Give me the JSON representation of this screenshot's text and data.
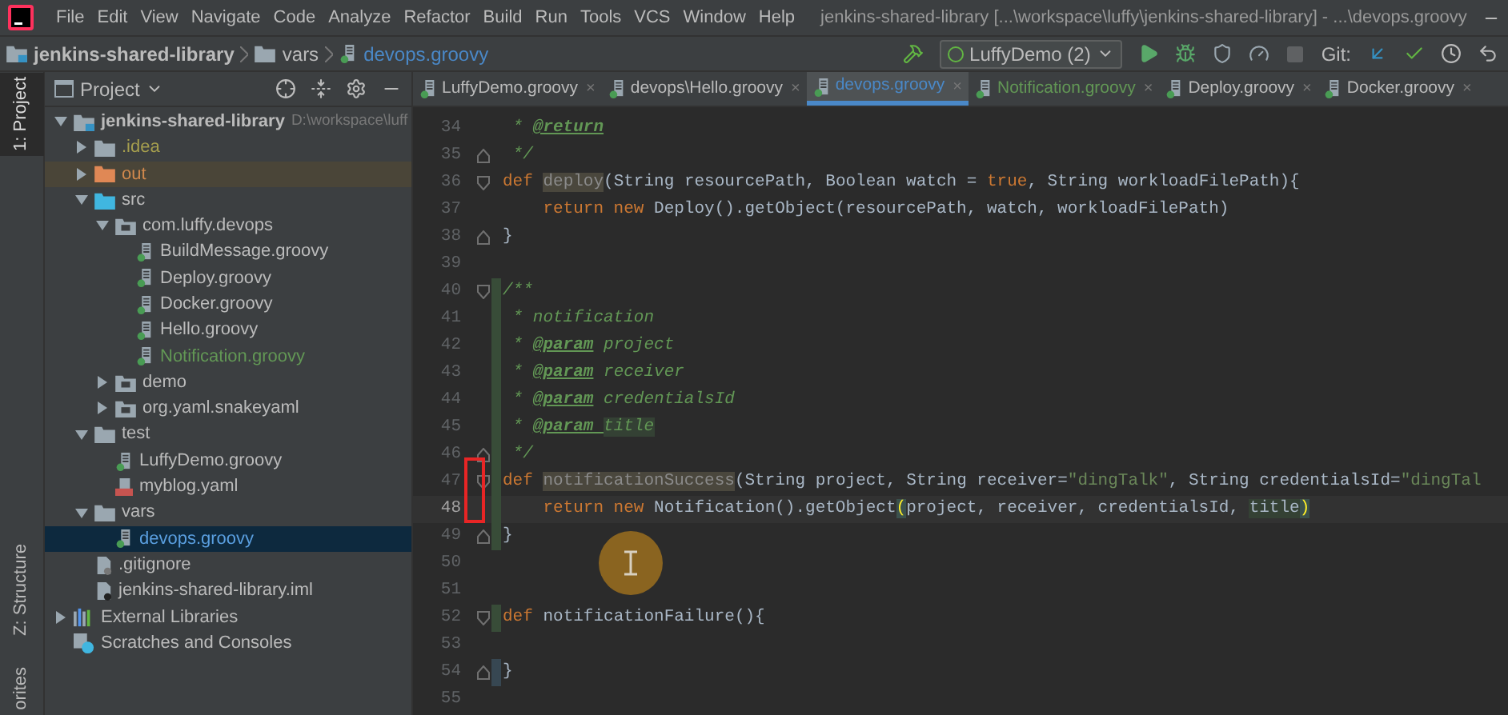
{
  "title_bar": {
    "menu": [
      "File",
      "Edit",
      "View",
      "Navigate",
      "Code",
      "Analyze",
      "Refactor",
      "Build",
      "Run",
      "Tools",
      "VCS",
      "Window",
      "Help"
    ],
    "title": "jenkins-shared-library [...\\workspace\\luffy\\jenkins-shared-library] - ...\\devops.groovy"
  },
  "nav_bar": {
    "breadcrumbs": [
      {
        "label": "jenkins-shared-library",
        "kind": "module"
      },
      {
        "label": "vars",
        "kind": "folder"
      },
      {
        "label": "devops.groovy",
        "kind": "groovy"
      }
    ],
    "run_config": "LuffyDemo (2)",
    "git_label": "Git:"
  },
  "side_strip": {
    "top": [
      {
        "label": "1: Project",
        "selected": true
      }
    ],
    "bottom": [
      {
        "label": "Z: Structure",
        "selected": false
      },
      {
        "label": "orites",
        "selected": false
      }
    ]
  },
  "project_panel": {
    "title": "Project",
    "tree": [
      {
        "name": "jenkins-shared-library",
        "path": "D:\\workspace\\luff",
        "kind": "module",
        "color": "#bbbbbb",
        "expanded": true,
        "selected": false,
        "children": [
          {
            "name": ".idea",
            "kind": "folder",
            "color": "#a59e4e",
            "expanded": false,
            "selected": false
          },
          {
            "name": "out",
            "kind": "excluded-folder",
            "color": "#d0884d",
            "expanded": false,
            "selected": false
          },
          {
            "name": "src",
            "kind": "source-folder",
            "color": "#bbbbbb",
            "expanded": true,
            "selected": false,
            "children": [
              {
                "name": "com.luffy.devops",
                "kind": "package",
                "color": "#bbbbbb",
                "expanded": true,
                "selected": false,
                "children": [
                  {
                    "name": "BuildMessage.groovy",
                    "kind": "groovy",
                    "color": "#bbbbbb",
                    "selected": false
                  },
                  {
                    "name": "Deploy.groovy",
                    "kind": "groovy",
                    "color": "#bbbbbb",
                    "selected": false
                  },
                  {
                    "name": "Docker.groovy",
                    "kind": "groovy",
                    "color": "#bbbbbb",
                    "selected": false
                  },
                  {
                    "name": "Hello.groovy",
                    "kind": "groovy",
                    "color": "#bbbbbb",
                    "selected": false
                  },
                  {
                    "name": "Notification.groovy",
                    "kind": "groovy",
                    "color": "#629755",
                    "selected": false
                  }
                ]
              },
              {
                "name": "demo",
                "kind": "package",
                "color": "#bbbbbb",
                "expanded": false,
                "selected": false
              },
              {
                "name": "org.yaml.snakeyaml",
                "kind": "package",
                "color": "#bbbbbb",
                "expanded": false,
                "selected": false
              }
            ]
          },
          {
            "name": "test",
            "kind": "folder",
            "color": "#bbbbbb",
            "expanded": true,
            "selected": false,
            "children": [
              {
                "name": "LuffyDemo.groovy",
                "kind": "groovy",
                "color": "#bbbbbb",
                "selected": false
              },
              {
                "name": "myblog.yaml",
                "kind": "yaml",
                "color": "#bbbbbb",
                "selected": false
              }
            ]
          },
          {
            "name": "vars",
            "kind": "folder",
            "color": "#bbbbbb",
            "expanded": true,
            "selected": false,
            "children": [
              {
                "name": "devops.groovy",
                "kind": "groovy",
                "selected": true
              }
            ]
          },
          {
            "name": ".gitignore",
            "kind": "ignore-file",
            "color": "#bbbbbb",
            "selected": false
          },
          {
            "name": "jenkins-shared-library.iml",
            "kind": "iml",
            "color": "#bbbbbb",
            "selected": false
          }
        ]
      },
      {
        "name": "External Libraries",
        "kind": "libraries",
        "color": "#bbbbbb",
        "expanded": false,
        "selected": false
      },
      {
        "name": "Scratches and Consoles",
        "kind": "scratches",
        "color": "#bbbbbb",
        "selected": false
      }
    ]
  },
  "editor": {
    "tabs": [
      {
        "label": "LuffyDemo.groovy",
        "close": "×",
        "color": "#bbbbbb",
        "selected": false
      },
      {
        "label": "devops\\Hello.groovy",
        "close": "×",
        "color": "#bbbbbb",
        "selected": false
      },
      {
        "label": "devops.groovy",
        "close": "×",
        "color": "#4a88c7",
        "selected": true
      },
      {
        "label": "Notification.groovy",
        "close": "×",
        "color": "#629755",
        "selected": false
      },
      {
        "label": "Deploy.groovy",
        "close": "×",
        "color": "#bbbbbb",
        "selected": false
      },
      {
        "label": "Docker.groovy",
        "close": "×",
        "color": "#bbbbbb",
        "selected": false
      }
    ],
    "lines": [
      {
        "number": "34",
        "kind": "plain",
        "current": false,
        "segments": [
          {
            "kind": "comment",
            "text": " * "
          },
          {
            "kind": "tag",
            "text": "@return"
          }
        ]
      },
      {
        "number": "35",
        "kind": "fold-end",
        "current": false,
        "segments": [
          {
            "kind": "comment",
            "text": " */"
          }
        ]
      },
      {
        "number": "36",
        "kind": "fold-start",
        "current": false,
        "segments": [
          {
            "kind": "kw",
            "text": "def "
          },
          {
            "kind": "unused",
            "text": "deploy"
          },
          {
            "kind": "plain",
            "text": "(String resourcePath, Boolean watch = "
          },
          {
            "kind": "kw",
            "text": "true"
          },
          {
            "kind": "plain",
            "text": ", String workloadFilePath){"
          }
        ]
      },
      {
        "number": "37",
        "kind": "plain",
        "current": false,
        "segments": [
          {
            "kind": "kw",
            "text": "    return new "
          },
          {
            "kind": "plain",
            "text": "Deploy().getObject(resourcePath, watch, workloadFilePath)"
          }
        ]
      },
      {
        "number": "38",
        "kind": "fold-end",
        "current": false,
        "segments": [
          {
            "kind": "plain",
            "text": "}"
          }
        ]
      },
      {
        "number": "39",
        "kind": "plain",
        "current": false
      },
      {
        "number": "40",
        "kind": "fold-start",
        "current": false,
        "color": "#384c38",
        "segments": [
          {
            "kind": "comment",
            "text": "/**"
          }
        ]
      },
      {
        "number": "41",
        "kind": "plain",
        "current": false,
        "color": "#384c38",
        "segments": [
          {
            "kind": "comment",
            "text": " * notification"
          }
        ]
      },
      {
        "number": "42",
        "kind": "plain",
        "current": false,
        "color": "#384c38",
        "segments": [
          {
            "kind": "comment",
            "text": " * "
          },
          {
            "kind": "tag",
            "text": "@param"
          },
          {
            "kind": "comment",
            "text": " project"
          }
        ]
      },
      {
        "number": "43",
        "kind": "plain",
        "current": false,
        "color": "#384c38",
        "segments": [
          {
            "kind": "comment",
            "text": " * "
          },
          {
            "kind": "tag",
            "text": "@param"
          },
          {
            "kind": "comment",
            "text": " receiver"
          }
        ]
      },
      {
        "number": "44",
        "kind": "plain",
        "current": false,
        "color": "#384c38",
        "segments": [
          {
            "kind": "comment",
            "text": " * "
          },
          {
            "kind": "tag",
            "text": "@param"
          },
          {
            "kind": "comment",
            "text": " credentialsId"
          }
        ]
      },
      {
        "number": "45",
        "kind": "plain",
        "current": false,
        "color": "#384c38",
        "segments": [
          {
            "kind": "comment",
            "text": " * "
          },
          {
            "kind": "tag",
            "text": "@param "
          },
          {
            "kind": "comment-hl",
            "text": "title"
          }
        ]
      },
      {
        "number": "46",
        "kind": "fold-end",
        "current": false,
        "color": "#384c38",
        "segments": [
          {
            "kind": "comment",
            "text": " */"
          }
        ]
      },
      {
        "number": "47",
        "kind": "fold-start",
        "current": false,
        "color": "#384c38",
        "segments": [
          {
            "kind": "kw",
            "text": "def "
          },
          {
            "kind": "unused",
            "text": "notificationSuccess"
          },
          {
            "kind": "plain",
            "text": "(String project, String receiver="
          },
          {
            "kind": "str",
            "text": "\"dingTalk\""
          },
          {
            "kind": "plain",
            "text": ", String credentialsId="
          },
          {
            "kind": "str",
            "text": "\"dingTal"
          }
        ]
      },
      {
        "number": "48",
        "kind": "plain",
        "current": true,
        "color": "#384c38",
        "segments": [
          {
            "kind": "kw",
            "text": "    return new "
          },
          {
            "kind": "plain",
            "text": "Notification().getObject"
          },
          {
            "kind": "brace",
            "text": "("
          },
          {
            "kind": "plain",
            "text": "project, receiver, credentialsId, "
          },
          {
            "kind": "ident-hl",
            "text": "title"
          },
          {
            "kind": "brace",
            "text": ")"
          }
        ]
      },
      {
        "number": "49",
        "kind": "fold-end",
        "current": false,
        "color": "#384c38",
        "segments": [
          {
            "kind": "plain",
            "text": "}"
          }
        ]
      },
      {
        "number": "50",
        "kind": "plain",
        "current": false
      },
      {
        "number": "51",
        "kind": "plain",
        "current": false
      },
      {
        "number": "52",
        "kind": "fold-start",
        "current": false,
        "color": "#384c38",
        "segments": [
          {
            "kind": "kw",
            "text": "def "
          },
          {
            "kind": "plain",
            "text": "notificationFailure(){"
          }
        ]
      },
      {
        "number": "53",
        "kind": "plain",
        "current": false
      },
      {
        "number": "54",
        "kind": "fold-end",
        "current": false,
        "color": "#374752",
        "segments": [
          {
            "kind": "plain",
            "text": "}"
          }
        ]
      },
      {
        "number": "55",
        "kind": "plain",
        "current": false
      }
    ]
  }
}
